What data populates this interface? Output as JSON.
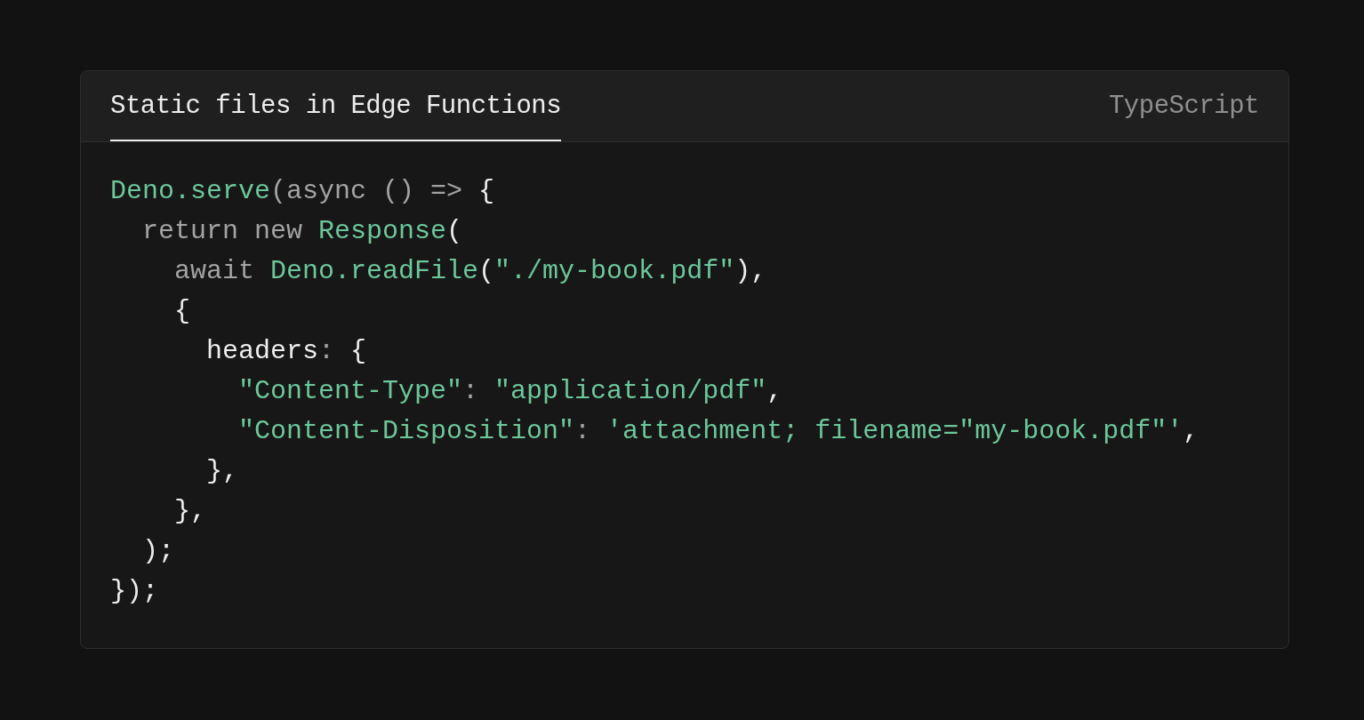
{
  "tabs": [
    {
      "label": "Static files in Edge Functions",
      "selected": true
    }
  ],
  "language": "TypeScript",
  "code_lines": [
    [
      {
        "kind": "fn",
        "text": "Deno.serve"
      },
      {
        "kind": "keyword",
        "text": "(async () => "
      },
      {
        "kind": "plain",
        "text": "{"
      }
    ],
    [
      {
        "kind": "keyword",
        "text": "  return new "
      },
      {
        "kind": "fn",
        "text": "Response"
      },
      {
        "kind": "plain",
        "text": "("
      }
    ],
    [
      {
        "kind": "keyword",
        "text": "    await "
      },
      {
        "kind": "fn",
        "text": "Deno.readFile"
      },
      {
        "kind": "plain",
        "text": "("
      },
      {
        "kind": "string",
        "text": "\"./my-book.pdf\""
      },
      {
        "kind": "plain",
        "text": "),"
      }
    ],
    [
      {
        "kind": "plain",
        "text": "    {"
      }
    ],
    [
      {
        "kind": "plain",
        "text": "      headers"
      },
      {
        "kind": "keyword",
        "text": ": "
      },
      {
        "kind": "plain",
        "text": "{"
      }
    ],
    [
      {
        "kind": "string",
        "text": "        \"Content-Type\""
      },
      {
        "kind": "keyword",
        "text": ": "
      },
      {
        "kind": "string",
        "text": "\"application/pdf\""
      },
      {
        "kind": "plain",
        "text": ","
      }
    ],
    [
      {
        "kind": "string",
        "text": "        \"Content-Disposition\""
      },
      {
        "kind": "keyword",
        "text": ": "
      },
      {
        "kind": "string",
        "text": "'attachment; filename=\"my-book.pdf\"'"
      },
      {
        "kind": "plain",
        "text": ","
      }
    ],
    [
      {
        "kind": "plain",
        "text": "      },"
      }
    ],
    [
      {
        "kind": "plain",
        "text": "    },"
      }
    ],
    [
      {
        "kind": "plain",
        "text": "  );"
      }
    ],
    [
      {
        "kind": "plain",
        "text": "});"
      }
    ]
  ]
}
